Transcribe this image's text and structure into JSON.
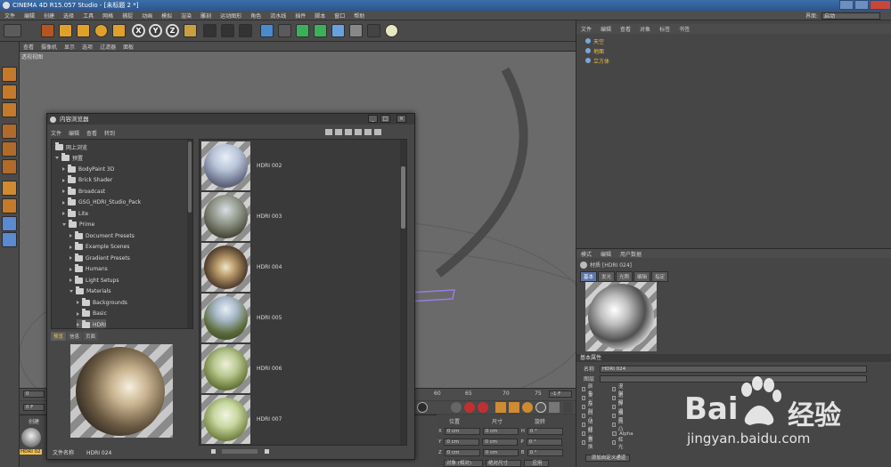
{
  "app": {
    "title": "CINEMA 4D R15.057 Studio - [未标题 2 *]",
    "menus": [
      "文件",
      "编辑",
      "创建",
      "选择",
      "工具",
      "网格",
      "捕捉",
      "动画",
      "模拟",
      "渲染",
      "雕刻",
      "运动图形",
      "角色",
      "流水线",
      "插件",
      "脚本",
      "窗口",
      "帮助"
    ],
    "interface_label": "界面:",
    "interface_value": "启动"
  },
  "viewport": {
    "menus": [
      "查看",
      "摄像机",
      "显示",
      "选项",
      "过滤器",
      "面板"
    ],
    "label": "透视视图"
  },
  "timeline": {
    "ticks": [
      "60",
      "65",
      "70",
      "75"
    ],
    "frame_end": "-1 F",
    "field_a": "0",
    "field_b": "0 F"
  },
  "object_manager": {
    "menus": [
      "文件",
      "编辑",
      "查看",
      "对象",
      "标签",
      "书签"
    ],
    "objects": [
      {
        "name": "天空"
      },
      {
        "name": "地面"
      },
      {
        "name": "立方体"
      }
    ]
  },
  "attribute_manager": {
    "menus": [
      "模式",
      "编辑",
      "用户数据"
    ],
    "material_title": "材质 [HDRI 024]",
    "tabs": [
      "基本",
      "发光",
      "光照",
      "编辑",
      "指定"
    ],
    "section": "基本属性",
    "name_label": "名称",
    "name_value": "HDRI 024",
    "layer_label": "图层",
    "channels_left": [
      "颜色",
      "发光",
      "反射",
      "凹凸",
      "法线",
      "辉光",
      "置换"
    ],
    "channels_right": [
      "漫射",
      "透明",
      "环境",
      "烟雾",
      "凹凸",
      "Alpha",
      "辉光"
    ],
    "add_button": "添加自定义通道"
  },
  "content_browser": {
    "title": "内容浏览器",
    "menus": [
      "文件",
      "编辑",
      "查看",
      "转到"
    ],
    "tree": [
      {
        "label": "网上浏览",
        "level": 0,
        "arrow": "none"
      },
      {
        "label": "预置",
        "level": 0,
        "arrow": "down"
      },
      {
        "label": "BodyPaint 3D",
        "level": 1,
        "arrow": "right"
      },
      {
        "label": "Brick Shader",
        "level": 1,
        "arrow": "right"
      },
      {
        "label": "Broadcast",
        "level": 1,
        "arrow": "right"
      },
      {
        "label": "GSG_HDRI_Studio_Pack",
        "level": 1,
        "arrow": "right"
      },
      {
        "label": "Lite",
        "level": 1,
        "arrow": "right"
      },
      {
        "label": "Prime",
        "level": 1,
        "arrow": "down"
      },
      {
        "label": "Document Presets",
        "level": 2,
        "arrow": "right"
      },
      {
        "label": "Example Scenes",
        "level": 2,
        "arrow": "right"
      },
      {
        "label": "Gradient Presets",
        "level": 2,
        "arrow": "right"
      },
      {
        "label": "Humans",
        "level": 2,
        "arrow": "right"
      },
      {
        "label": "Light Setups",
        "level": 2,
        "arrow": "right"
      },
      {
        "label": "Materials",
        "level": 2,
        "arrow": "down"
      },
      {
        "label": "Backgrounds",
        "level": 3,
        "arrow": "right"
      },
      {
        "label": "Basic",
        "level": 3,
        "arrow": "right"
      },
      {
        "label": "HDRI",
        "level": 3,
        "arrow": "right"
      }
    ],
    "preview_tabs": [
      "预览",
      "信息",
      "页面"
    ],
    "file_label": "文件名称",
    "file_name": "HDRI 024",
    "items": [
      "HDRI 002",
      "HDRI 003",
      "HDRI 004",
      "HDRI 005",
      "HDRI 006",
      "HDRI 007"
    ]
  },
  "material_manager": {
    "tab": "创建",
    "material": "HDRI 02"
  },
  "coordinates": {
    "headers": [
      "位置",
      "尺寸",
      "旋转"
    ],
    "rows": [
      {
        "axis": "X",
        "pos": "0 cm",
        "size": "0 cm",
        "rot_axis": "H",
        "rot": "0 °"
      },
      {
        "axis": "Y",
        "pos": "0 cm",
        "size": "0 cm",
        "rot_axis": "P",
        "rot": "0 °"
      },
      {
        "axis": "Z",
        "pos": "0 cm",
        "size": "0 cm",
        "rot_axis": "B",
        "rot": "0 °"
      }
    ],
    "mode1": "对象 (相对)",
    "mode2": "绝对尺寸",
    "apply": "应用"
  },
  "watermark": {
    "line1": "Bai",
    "line2": "经验",
    "url": "jingyan.baidu.com"
  },
  "colors": {
    "accent": "#f2c04a",
    "selection": "#5b76a8",
    "title": "#2b5690"
  }
}
